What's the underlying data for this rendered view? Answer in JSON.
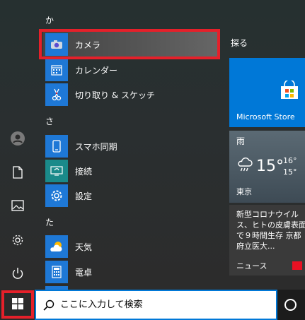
{
  "app_list": {
    "section_ka": "か",
    "camera": "カメラ",
    "calendar": "カレンダー",
    "snip": "切り取り & スケッチ",
    "section_sa": "さ",
    "phone": "スマホ同期",
    "connect": "接続",
    "settings": "設定",
    "section_ta": "た",
    "weather": "天気",
    "calculator": "電卓"
  },
  "tiles": {
    "header": "探る",
    "store": "Microsoft Store",
    "weather": {
      "condition": "雨",
      "temp": "15°",
      "high": "16°",
      "low": "15°",
      "city": "東京"
    },
    "news": {
      "headline": "新型コロナウイルス、ヒトの皮膚表面で９時間生存 京都府立医大...",
      "label": "ニュース"
    }
  },
  "taskbar": {
    "search_placeholder": "ここに入力して検索"
  },
  "colors": {
    "accent": "#0078d7",
    "highlight": "#e5202a"
  }
}
